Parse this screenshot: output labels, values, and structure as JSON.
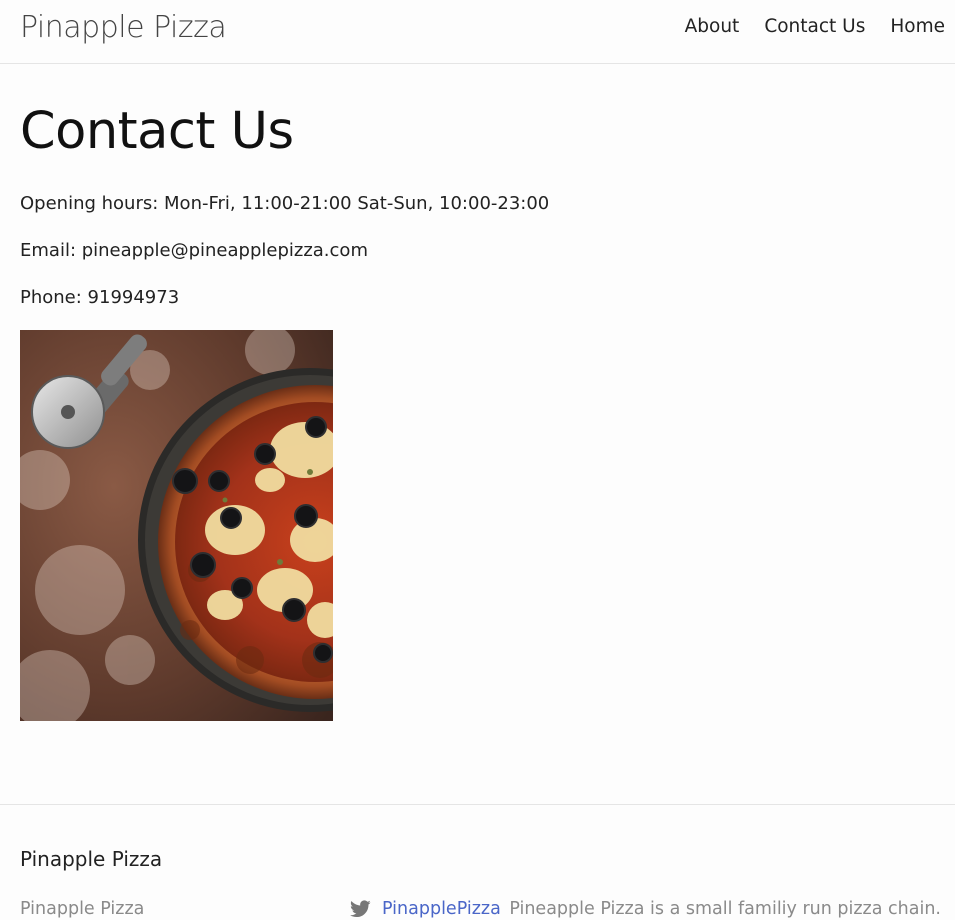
{
  "navbar": {
    "brand": "Pinapple Pizza",
    "links": [
      "About",
      "Contact Us",
      "Home"
    ]
  },
  "main": {
    "title": "Contact Us",
    "hours": "Opening hours: Mon-Fri, 11:00-21:00 Sat-Sun, 10:00-23:00",
    "email": "Email: pineapple@pineapplepizza.com",
    "phone": "Phone: 91994973"
  },
  "footer": {
    "title": "Pinapple Pizza",
    "brand": "Pinapple Pizza",
    "twitter_handle": "PinapplePizza",
    "description": "Pineapple Pizza is a small familiy run pizza chain."
  },
  "colors": {
    "link": "#4a66c8",
    "muted": "#8a8a8a",
    "divider": "#e5e5e5"
  },
  "icons": {
    "twitter": "twitter-icon"
  }
}
